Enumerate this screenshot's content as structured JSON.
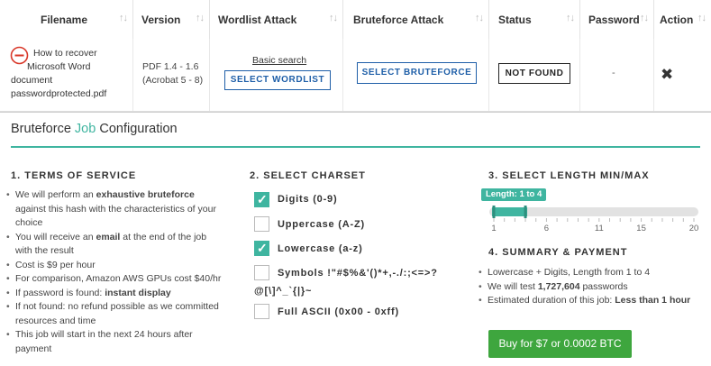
{
  "table": {
    "headers": [
      {
        "label": "Filename"
      },
      {
        "label": "Version"
      },
      {
        "label": "Wordlist Attack"
      },
      {
        "label": "Bruteforce Attack"
      },
      {
        "label": "Status"
      },
      {
        "label": "Password"
      },
      {
        "label": "Action"
      }
    ],
    "sort_glyph": "↑↓",
    "row": {
      "filename_lines": [
        "How to recover",
        "Microsoft Word",
        "document",
        "passwordprotected.pdf"
      ],
      "version_lines": [
        "PDF 1.4 - 1.6",
        "(Acrobat 5 - 8)"
      ],
      "basic_search": "Basic search",
      "select_wordlist": "SELECT WORDLIST",
      "select_bruteforce": "SELECT BRUTEFORCE",
      "status": "NOT FOUND",
      "password": "-",
      "remove_glyph": "✖"
    }
  },
  "config": {
    "title_part1": "Bruteforce ",
    "title_part2": "Job",
    "title_part3": " Configuration",
    "accent_color": "#3fb5a0",
    "terms": {
      "heading": "1. TERMS OF SERVICE",
      "items": [
        {
          "pre": "We will perform an ",
          "bold": "exhaustive bruteforce",
          "post": " against this hash with the characteristics of your choice"
        },
        {
          "pre": "You will receive an ",
          "bold": "email",
          "post": " at the end of the job with the result"
        },
        {
          "pre": "Cost is $9 per hour",
          "bold": "",
          "post": ""
        },
        {
          "pre": "For comparison, Amazon AWS GPUs cost $40/hr",
          "bold": "",
          "post": ""
        },
        {
          "pre": "If password is found: ",
          "bold": "instant display",
          "post": ""
        },
        {
          "pre": "If not found: no refund possible as we committed resources and time",
          "bold": "",
          "post": ""
        },
        {
          "pre": "This job will start in the next 24 hours after payment",
          "bold": "",
          "post": ""
        }
      ]
    },
    "charset": {
      "heading": "2. SELECT CHARSET",
      "options": [
        {
          "label": "Digits (0-9)",
          "checked": true
        },
        {
          "label": "Uppercase (A-Z)",
          "checked": false
        },
        {
          "label": "Lowercase (a-z)",
          "checked": true
        },
        {
          "label": "Symbols !\"#$%&'()*+,-./:;<=>?",
          "label2": "@[\\]^_`{|}~",
          "checked": false
        },
        {
          "label": "Full ASCII (0x00 - 0xff)",
          "checked": false
        }
      ]
    },
    "length": {
      "heading": "3. SELECT LENGTH MIN/MAX",
      "tooltip": "Length: 1 to 4",
      "min": 1,
      "max": 20,
      "selected_min": 1,
      "selected_max": 4,
      "tick_labels": [
        "1",
        "6",
        "11",
        "15",
        "20"
      ]
    },
    "summary": {
      "heading": "4. SUMMARY & PAYMENT",
      "line1": "Lowercase + Digits, Length from 1 to 4",
      "line2_pre": "We will test ",
      "line2_bold": "1,727,604",
      "line2_post": " passwords",
      "line3_pre": "Estimated duration of this job: ",
      "line3_bold": "Less than 1 hour"
    },
    "buy_button": "Buy for $7 or 0.0002 BTC",
    "buy_color": "#3ea63e"
  }
}
